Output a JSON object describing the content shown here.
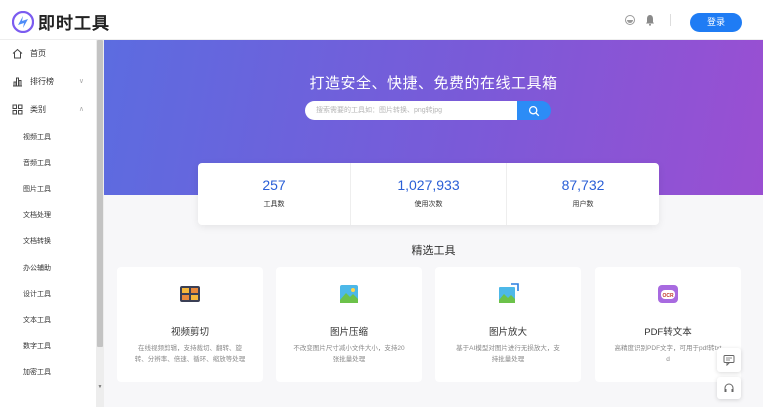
{
  "header": {
    "logo_text": "即时工具",
    "login_label": "登录",
    "icons": [
      "theme-icon",
      "notification-bell-icon"
    ]
  },
  "sidebar": {
    "items": [
      {
        "label": "首页",
        "icon": "home-icon"
      },
      {
        "label": "排行榜",
        "icon": "ranking-icon",
        "chevron": "∨"
      },
      {
        "label": "类别",
        "icon": "category-icon",
        "chevron": "∧"
      }
    ],
    "categories": [
      "视频工具",
      "音频工具",
      "图片工具",
      "文档处理",
      "文档转换",
      "办公辅助",
      "设计工具",
      "文本工具",
      "数字工具",
      "加密工具"
    ]
  },
  "hero": {
    "title": "打造安全、快捷、免费的在线工具箱",
    "search_placeholder": "搜索需要的工具如：图片转换、png转jpg"
  },
  "stats": [
    {
      "value": "257",
      "label": "工具数"
    },
    {
      "value": "1,027,933",
      "label": "使用次数"
    },
    {
      "value": "87,732",
      "label": "用户数"
    }
  ],
  "featured": {
    "title": "精选工具",
    "cards": [
      {
        "name": "视频剪切",
        "desc_line1": "在线视频剪辑，支持裁切、翻转、旋",
        "desc_line2": "转、分辨率、倍速、循环、缩放等处理",
        "icon": "video-cut-icon"
      },
      {
        "name": "图片压缩",
        "desc_line1": "不改变图片尺寸减小文件大小，支持20",
        "desc_line2": "张批量处理",
        "icon": "image-compress-icon"
      },
      {
        "name": "图片放大",
        "desc_line1": "基于AI模型对图片进行无损放大，支",
        "desc_line2": "持批量处理",
        "icon": "image-enlarge-icon"
      },
      {
        "name": "PDF转文本",
        "desc_line1": "高精度识别PDF文字，可用于pdf转txt",
        "desc_line2": "d",
        "icon": "pdf-ocr-icon"
      }
    ]
  },
  "colors": {
    "accent": "#1f7cf4",
    "stat_number": "#2a5fd6",
    "hero_gradient_start": "#5c6ce0",
    "hero_gradient_end": "#9a4fd2"
  }
}
